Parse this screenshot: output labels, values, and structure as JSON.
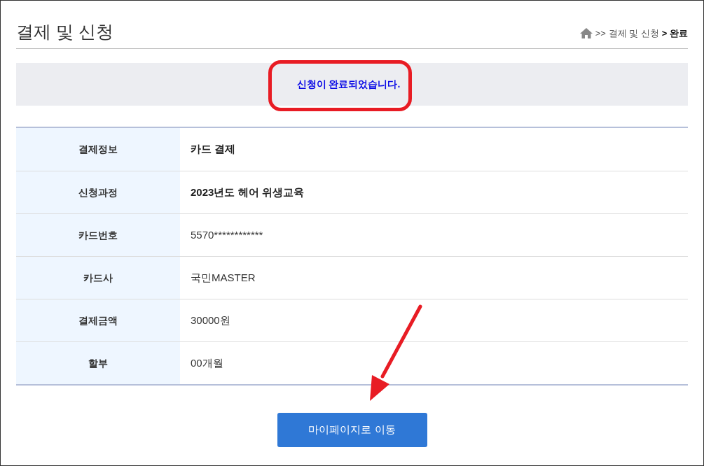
{
  "page_title": "결제 및 신청",
  "breadcrumb": [
    {
      "label": ">> 결제 및 신청",
      "current": false
    },
    {
      "label": "> 완료",
      "current": true
    }
  ],
  "notice": "신청이 완료되었습니다.",
  "rows": [
    {
      "label": "결제정보",
      "value": "카드 결제",
      "kind": "emphasis"
    },
    {
      "label": "신청과정",
      "value": "2023년도 헤어 위생교육",
      "kind": "emphasis"
    },
    {
      "label": "카드번호",
      "value": "5570************",
      "kind": "plain"
    },
    {
      "label": "카드사",
      "value": "국민MASTER",
      "kind": "plain"
    },
    {
      "label": "결제금액",
      "value": "30000원",
      "kind": "plain"
    },
    {
      "label": "할부",
      "value": "00개월",
      "kind": "plain"
    }
  ],
  "button": "마이페이지로 이동"
}
